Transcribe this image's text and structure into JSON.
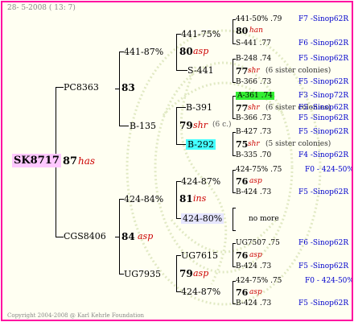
{
  "header": {
    "date": "28- 5-2008 ( 13: 7)"
  },
  "footer": {
    "copyright": "Copyright 2004-2008 @ Karl Kehrle Foundation"
  },
  "root": {
    "id": "SK8717",
    "score": "87",
    "breed": "has"
  },
  "gen1": {
    "father": {
      "id": "PC8363",
      "score": "83"
    },
    "mother": {
      "id": "CGS8406",
      "score": "84",
      "breed": "asp"
    }
  },
  "gen2": {
    "ff": {
      "id": "441-87%",
      "score": "80",
      "breed": "asp"
    },
    "fm": {
      "id": "B-135",
      "score": "79",
      "breed": "shr",
      "note": "(6 c.)"
    },
    "mf": {
      "id": "424-84%",
      "score": "81",
      "breed": "ins"
    },
    "mm": {
      "id": "UG7935",
      "score": "79",
      "breed": "asp"
    }
  },
  "gen3": {
    "fff": {
      "id": "441-75%"
    },
    "ffm": {
      "id": "S-441"
    },
    "fmf": {
      "id": "B-391"
    },
    "fmm": {
      "id": "B-292"
    },
    "mff": {
      "id": "424-87%",
      "score": "76",
      "breed": "asp"
    },
    "mfm": {
      "id": "424-80%",
      "note": "no more"
    },
    "mmf": {
      "id": "UG7615",
      "score": "76",
      "breed": "asp"
    },
    "mmm": {
      "id": "424-87%",
      "score": "76",
      "breed": "asp"
    }
  },
  "gen4": {
    "g1": {
      "top": "441-50%  .79",
      "score": "80",
      "breed": "han",
      "bottom": "S-441  .77",
      "src_top": "F7 -Sinop62R",
      "src_bottom": "F6 -Sinop62R"
    },
    "g2": {
      "top": "B-248  .74",
      "score": "77",
      "breed": "shr",
      "note": "(6 sister colonies)",
      "bottom": "B-366  .73",
      "src_top": "F5 -Sinop62R",
      "src_bottom": "F5 -Sinop62R"
    },
    "g3": {
      "top": "A-361  .74",
      "score": "77",
      "breed": "shr",
      "note": "(6 sister colonies)",
      "bottom": "B-366  .73",
      "src_top": "F3 -Sinop72R",
      "src_mid": "F5 -Sinop62R",
      "src_bottom": "F5 -Sinop62R"
    },
    "g4": {
      "top": "B-427  .73",
      "score": "75",
      "breed": "shr",
      "note": "(5 sister colonies)",
      "bottom": "B-335  .70",
      "src_top": "F5 -Sinop62R",
      "src_bottom": "F4 -Sinop62R"
    },
    "g5": {
      "top": "424-75%  .75",
      "score": "76",
      "breed": "asp",
      "bottom": "B-424  .73",
      "src_top": "F0 - 424-50%",
      "src_bottom": "F5 -Sinop62R"
    },
    "g6": {
      "top": "UG7507  .75",
      "score": "76",
      "breed": "asp",
      "bottom": "B-424  .73",
      "src_top": "F6 -Sinop62R",
      "src_bottom": "F5 -Sinop62R"
    },
    "g7": {
      "top": "424-75%  .75",
      "score": "76",
      "breed": "asp",
      "bottom": "B-424  .73",
      "src_top": "F0 - 424-50%",
      "src_bottom": "F5 -Sinop62R"
    }
  },
  "colors": {
    "border": "#ff0aa0",
    "breed": "#cc0000",
    "source": "#0000cc",
    "highlight_root": "#ffc8ff",
    "highlight_cyan": "#44ffff",
    "highlight_green": "#33ee33"
  }
}
